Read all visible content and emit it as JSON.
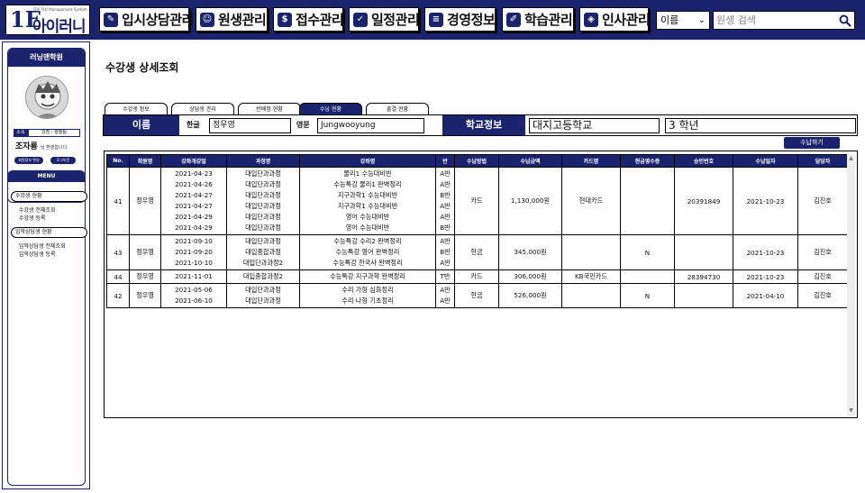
{
  "logo": {
    "mark": "1E",
    "name": "아이러니",
    "sub": "학원 학원 Management System"
  },
  "nav": [
    {
      "label": "입시상담관리",
      "icon": "chat-icon"
    },
    {
      "label": "원생관리",
      "icon": "students-icon"
    },
    {
      "label": "접수관리",
      "icon": "dollar-icon"
    },
    {
      "label": "일정관리",
      "icon": "calendar-icon"
    },
    {
      "label": "경영정보",
      "icon": "report-icon"
    },
    {
      "label": "학습관리",
      "icon": "edit-icon"
    },
    {
      "label": "인사관리",
      "icon": "tag-icon"
    }
  ],
  "search": {
    "filter_value": "이름",
    "placeholder": "원생 검색"
  },
  "sidebar": {
    "academy_name": "러닝맨학원",
    "role_key": "소속",
    "role_value": "강점 - 행정팀",
    "user_name": "조자룡",
    "user_suffix": "님 환영합니다.",
    "btn_info": "회원정보 변경",
    "btn_logout": "로그아웃",
    "menu_title": "MENU",
    "groups": [
      {
        "label": "수강생 현황",
        "items": [
          "수강생 전체조회",
          "수강생 등록"
        ]
      },
      {
        "label": "입학상담생 현황",
        "items": [
          "입학상담생 전체조회",
          "입학상담생 등록"
        ]
      }
    ]
  },
  "page": {
    "title": "수강생 상세조회",
    "tabs": [
      "수강생 정보",
      "상담생 관리",
      "반배정 현황",
      "수납 현황",
      "출결 현황"
    ],
    "active_tab": 3,
    "name_label": "이름",
    "korean_label": "한글",
    "korean_value": "정우영",
    "english_label": "영문",
    "english_value": "Jungwooyung",
    "school_label": "학교정보",
    "school_value": "대지고등학교",
    "grade_value": "3 학년",
    "pay_button": "수납하기"
  },
  "table": {
    "headers": [
      "No.",
      "회원명",
      "강좌개강일",
      "과정명",
      "강좌명",
      "반",
      "수납방법",
      "수납금액",
      "카드명",
      "현금영수증",
      "승인번호",
      "수납일자",
      "담당자"
    ],
    "rows": [
      {
        "no": "41",
        "member": "정우영",
        "dates": [
          "2021-04-23",
          "2021-04-26",
          "2021-04-27",
          "2021-04-27",
          "2021-04-29",
          "2021-04-29"
        ],
        "courses": [
          "대입단과과정",
          "대입단과과정",
          "대입단과과정",
          "대입단과과정",
          "대입단과과정",
          "대입단과과정"
        ],
        "lectures": [
          "물리1 수능대비반",
          "수능특강 물리1 완벽정리",
          "지구과학1 수능대비반",
          "지구과학1 수능대비반",
          "영어 수능대비반",
          "영어 수능대비반"
        ],
        "classes": [
          "A반",
          "A반",
          "B반",
          "A반",
          "A반",
          "B반"
        ],
        "method": "카드",
        "amount": "1,130,000원",
        "card": "현대카드",
        "receipt": "",
        "approval": "20391849",
        "paid_date": "2021-10-23",
        "manager": "김진호"
      },
      {
        "no": "43",
        "member": "정우영",
        "dates": [
          "2021-09-10",
          "2021-09-20",
          "2021-10-10"
        ],
        "courses": [
          "대입단과과정",
          "대입종합과정",
          "대입단과과정2"
        ],
        "lectures": [
          "수능특강 수리2 완벽정리",
          "수능특강 영어 완벽정리",
          "수능특강 한국사 완벽정리"
        ],
        "classes": [
          "A반",
          "B반",
          "A반"
        ],
        "method": "현금",
        "amount": "345,000원",
        "card": "",
        "receipt": "N",
        "approval": "",
        "paid_date": "2021-10-23",
        "manager": "김진호"
      },
      {
        "no": "44",
        "member": "정우영",
        "dates": [
          "2021-11-01"
        ],
        "courses": [
          "대입종합과정2"
        ],
        "lectures": [
          "수능특강 지구과학 완벽정리"
        ],
        "classes": [
          "T반"
        ],
        "method": "카드",
        "amount": "306,000원",
        "card": "KB국민카드",
        "receipt": "",
        "approval": "28394730",
        "paid_date": "2021-10-23",
        "manager": "김진호"
      },
      {
        "no": "42",
        "member": "정우영",
        "dates": [
          "2021-05-06",
          "2021-06-10"
        ],
        "courses": [
          "대입단과과정",
          "대입단과과정"
        ],
        "lectures": [
          "수리 가형 심화정리",
          "수리 나형 기초정리"
        ],
        "classes": [
          "A반",
          "A반"
        ],
        "method": "현금",
        "amount": "526,000원",
        "card": "",
        "receipt": "N",
        "approval": "",
        "paid_date": "2021-04-10",
        "manager": "김진호"
      }
    ]
  },
  "colors": {
    "primary": "#1a236e",
    "border": "#000000"
  }
}
